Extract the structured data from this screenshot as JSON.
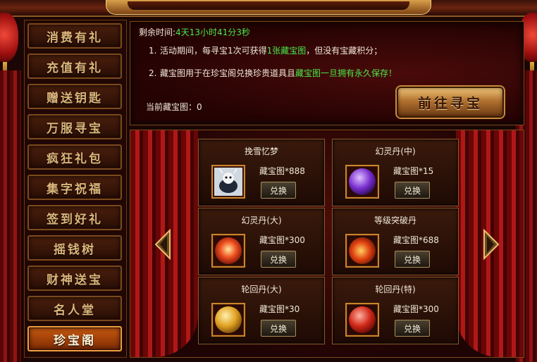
{
  "sidebar": {
    "items": [
      {
        "label": "消费有礼"
      },
      {
        "label": "充值有礼"
      },
      {
        "label": "赠送钥匙"
      },
      {
        "label": "万服寻宝"
      },
      {
        "label": "疯狂礼包"
      },
      {
        "label": "集字祝福"
      },
      {
        "label": "签到好礼"
      },
      {
        "label": "摇钱树"
      },
      {
        "label": "财神送宝"
      },
      {
        "label": "名人堂"
      },
      {
        "label": "珍宝阁"
      }
    ],
    "active_index": 10
  },
  "info": {
    "remaining_label": "剩余时间:",
    "remaining_value": "4天13小时41分3秒",
    "rule1": {
      "num": "1.",
      "text_a": "活动期间，每寻宝1次可获得",
      "highlight": "1张藏宝图",
      "text_b": "，但没有宝藏积分；"
    },
    "rule2": {
      "num": "2.",
      "text_a": "藏宝图用于在珍宝阁兑换珍贵道具且",
      "highlight": "藏宝图一旦拥有永久保存！"
    },
    "current_label": "当前藏宝图：",
    "current_value": "0",
    "go_button": "前往寻宝"
  },
  "exchange": {
    "button_label": "兑换",
    "items": [
      {
        "name": "挽雪忆梦",
        "cost": "藏宝图*888",
        "icon": "snow-pet-icon"
      },
      {
        "name": "幻灵丹(中)",
        "cost": "藏宝图*15",
        "icon": "purple-orb-icon"
      },
      {
        "name": "幻灵丹(大)",
        "cost": "藏宝图*300",
        "icon": "red-orb-icon"
      },
      {
        "name": "等级突破丹",
        "cost": "藏宝图*688",
        "icon": "fire-orb-icon"
      },
      {
        "name": "轮回丹(大)",
        "cost": "藏宝图*30",
        "icon": "gold-orb-icon"
      },
      {
        "name": "轮回丹(特)",
        "cost": "藏宝图*300",
        "icon": "crimson-orb-icon"
      }
    ]
  },
  "colors": {
    "highlight_green": "#49e84a",
    "active_tab": "#c85a10",
    "frame_gold": "#c8862a"
  }
}
